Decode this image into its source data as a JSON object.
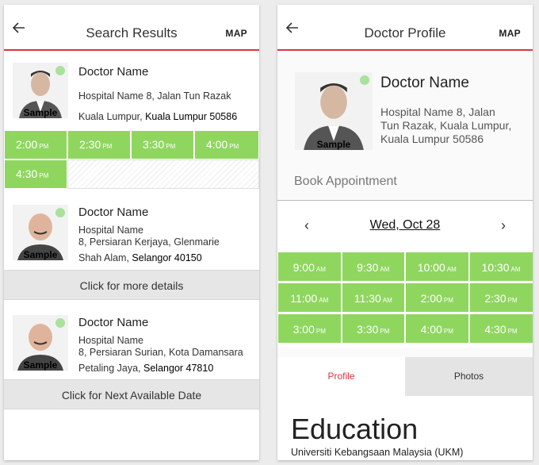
{
  "search": {
    "title": "Search Results",
    "map": "MAP",
    "photo_label": "Sample",
    "doctors": [
      {
        "name": "Doctor Name",
        "line1": "Hospital Name 8, Jalan Tun Razak",
        "city": "Kuala Lumpur,",
        "state": "Kuala Lumpur 50586",
        "slots": [
          "2:00",
          "2:30",
          "3:30",
          "4:00",
          "4:30"
        ],
        "suffix": "PM"
      },
      {
        "name": "Doctor Name",
        "line1": "Hospital Name",
        "line2": "8, Persiaran Kerjaya, Glenmarie",
        "city": "Shah Alam,",
        "state": "Selangor 40150",
        "action": "Click for more details"
      },
      {
        "name": "Doctor Name",
        "line1": "Hospital Name",
        "line2": "8, Persiaran Surian, Kota Damansara",
        "city": "Petaling Jaya,",
        "state": "Selangor 47810",
        "action": "Click for Next Available Date"
      }
    ]
  },
  "profile": {
    "title": "Doctor Profile",
    "map": "MAP",
    "photo_label": "Sample",
    "name": "Doctor Name",
    "address": [
      "Hospital Name 8, Jalan",
      "Tun Razak, Kuala Lumpur,",
      "Kuala Lumpur 50586"
    ],
    "book_label": "Book Appointment",
    "date": "Wed, Oct 28",
    "slots": [
      {
        "t": "9:00",
        "p": "AM"
      },
      {
        "t": "9:30",
        "p": "AM"
      },
      {
        "t": "10:00",
        "p": "AM"
      },
      {
        "t": "10:30",
        "p": "AM"
      },
      {
        "t": "11:00",
        "p": "AM"
      },
      {
        "t": "11:30",
        "p": "AM"
      },
      {
        "t": "2:00",
        "p": "PM"
      },
      {
        "t": "2:30",
        "p": "PM"
      },
      {
        "t": "3:00",
        "p": "PM"
      },
      {
        "t": "3:30",
        "p": "PM"
      },
      {
        "t": "4:00",
        "p": "PM"
      },
      {
        "t": "4:30",
        "p": "PM"
      }
    ],
    "tabs": [
      "Profile",
      "Photos"
    ],
    "section_title": "Education",
    "education": "Universiti Kebangsaan Malaysia (UKM)"
  },
  "colors": {
    "accent": "#d9363e",
    "slot": "#8fd65f",
    "tab_active": "#d9363e"
  },
  "icons": {
    "back": "arrow-left-icon",
    "prev": "chevron-left-icon",
    "next": "chevron-right-icon",
    "verified": "check-badge-icon"
  }
}
